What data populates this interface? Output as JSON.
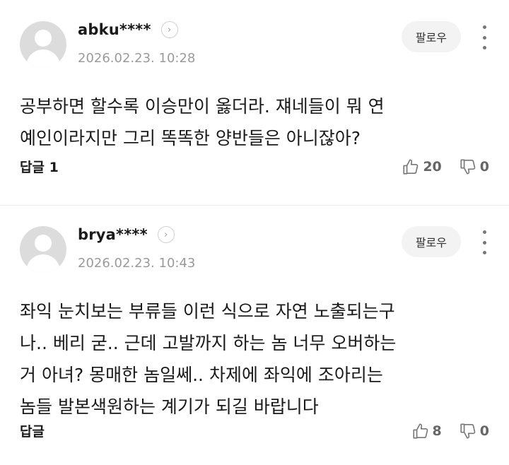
{
  "comments": [
    {
      "username": "abku****",
      "timestamp": "2026.02.23. 10:28",
      "follow_label": "팔로우",
      "content": "공부하면 할수록 이승만이 옳더라. 쟤네들이 뭐 연\n예인이라지만 그리 똑똑한 양반들은 아니잖아?",
      "reply_label": "답글 1",
      "likes": "20",
      "dislikes": "0"
    },
    {
      "username": "brya****",
      "timestamp": "2026.02.23. 10:43",
      "follow_label": "팔로우",
      "content": "좌익 눈치보는 부류들 이런 식으로 자연 노출되는구\n나.. 베리 굳.. 근데 고발까지 하는 놈 너무 오버하는\n거 아녀? 몽매한 놈일쎄.. 차제에 좌익에 조아리는\n놈들 발본색원하는 계기가 되길 바랍니다",
      "reply_label": "답글",
      "likes": "8",
      "dislikes": "0"
    }
  ],
  "icons": {
    "profile_arrow": "chevron-right-icon",
    "more": "more-vertical-icon",
    "like": "thumbs-up-icon",
    "dislike": "thumbs-down-icon"
  },
  "colors": {
    "text": "#1a1a1a",
    "muted": "#9a9a9a",
    "follow_bg": "#f3f3f3",
    "icon": "#777777"
  }
}
